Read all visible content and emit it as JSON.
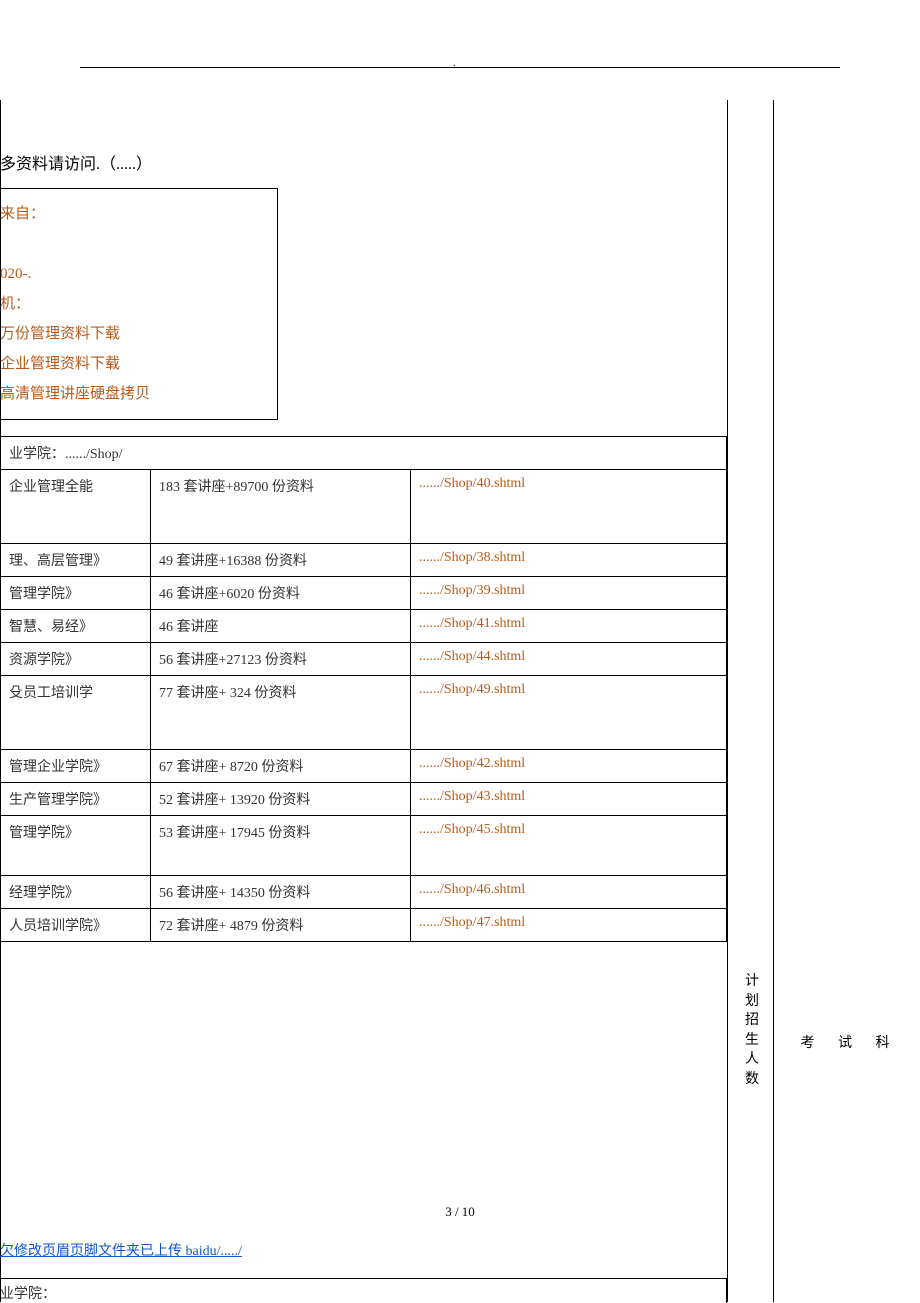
{
  "header": {
    "dot": "."
  },
  "title": "多资料请访问.（.....）",
  "promo": {
    "line1": "来自：",
    "line2": "020-.",
    "line3": "机：",
    "line4": "万份管理资料下载",
    "line5": "企业管理资料下载",
    "line6": "高清管理讲座硬盘拷贝"
  },
  "table1": {
    "header": "业学院：....../Shop/",
    "rows": [
      {
        "c1": "企业管理全能",
        "c2": "183 套讲座+89700 份资料",
        "c3": "....../Shop/40.shtml",
        "h": "tall"
      },
      {
        "c1": "理、高层管理》",
        "c2": "49 套讲座+16388 份资料",
        "c3": "....../Shop/38.shtml",
        "h": ""
      },
      {
        "c1": "管理学院》",
        "c2": "46 套讲座+6020 份资料",
        "c3": "....../Shop/39.shtml",
        "h": ""
      },
      {
        "c1": "智慧、易经》",
        "c2": "46 套讲座",
        "c3": "....../Shop/41.shtml",
        "h": ""
      },
      {
        "c1": "资源学院》",
        "c2": "56 套讲座+27123 份资料",
        "c3": "....../Shop/44.shtml",
        "h": ""
      },
      {
        "c1": "殳员工培训学",
        "c2": "77 套讲座+ 324 份资料",
        "c3": "....../Shop/49.shtml",
        "h": "tall"
      },
      {
        "c1": "管理企业学院》",
        "c2": "67 套讲座+ 8720 份资料",
        "c3": "....../Shop/42.shtml",
        "h": ""
      },
      {
        "c1": "生产管理学院》",
        "c2": "52 套讲座+ 13920 份资料",
        "c3": "....../Shop/43.shtml",
        "h": ""
      },
      {
        "c1": "管理学院》",
        "c2": "53 套讲座+ 17945 份资料",
        "c3": "....../Shop/45.shtml",
        "h": "med"
      },
      {
        "c1": "经理学院》",
        "c2": "56 套讲座+ 14350 份资料",
        "c3": "....../Shop/46.shtml",
        "h": ""
      },
      {
        "c1": "人员培训学院》",
        "c2": "72 套讲座+ 4879 份资料",
        "c3": "....../Shop/47.shtml",
        "h": ""
      }
    ]
  },
  "footer": {
    "page": "3 / 10",
    "link": "欠修改页眉页脚文件夹已上传 baidu/...../"
  },
  "table2": {
    "header": "业学院："
  },
  "side": {
    "plan": "计划招生人数",
    "exam": "考 试 科"
  }
}
